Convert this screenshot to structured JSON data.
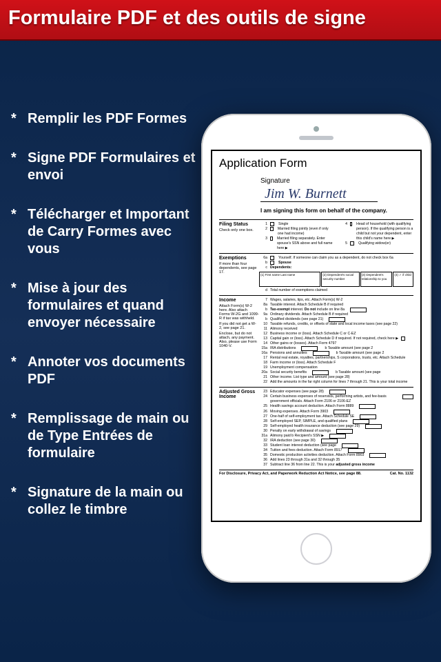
{
  "header": {
    "title": "Formulaire PDF et des outils de signe"
  },
  "features": [
    "Remplir les PDF Formes",
    "Signe PDF Formulaires et envoi",
    "Télécharger et Important de Carry Formes avec vous",
    "Mise à jour des formulaires et quand envoyer nécessaire",
    "Annoter vos documents PDF",
    "Remplissage de main ou de Type Entrées de formulaire",
    "Signature de la main ou collez le timbre"
  ],
  "form": {
    "title": "Application Form",
    "signature_label": "Signature",
    "signature_value": "Jim W. Burnett",
    "signature_note": "I am signing this form on behalf of the company.",
    "filing_status": {
      "label": "Filing Status",
      "sub": "Check only one box.",
      "options": [
        "Single",
        "Married filing jointly (even if only one had income)",
        "Married filing separately. Enter spouse's SSN above and full name here ▶",
        "Head of household (with qualifying person). If the qualifying person is a child but not your dependent, enter this child's name here ▶",
        "Qualifying widow(er)"
      ]
    },
    "exemptions": {
      "label": "Exemptions",
      "sub": "If more than four dependents, see page 17.",
      "a": "Yourself. If someone can claim you as a dependent, do not check box 6a",
      "b": "Spouse",
      "c": "Dependents:",
      "cols": [
        "(1) First name    Last name",
        "(2) Dependent's social security number",
        "(3) Dependent's relationship to you",
        "(4) ✓ if child"
      ],
      "d": "Total number of exemptions claimed"
    },
    "income": {
      "label": "Income",
      "sub": "Attach Form(s) W-2 here. Also attach Forms W-2G and 1099-R if tax was withheld.",
      "sub2": "If you did not get a W-2, see page 21.",
      "sub3": "Enclose, but do not attach, any payment. Also, please use Form 1040-V.",
      "lines": {
        "7": "Wages, salaries, tips, etc. Attach Form(s) W-2",
        "8a": "Taxable interest. Attach Schedule B if required",
        "8b": "Tax-exempt interest. Do not include on line 8a",
        "9a": "Ordinary dividends. Attach Schedule B if required",
        "9b": "Qualified dividends (see page 21)",
        "10": "Taxable refunds, credits, or offsets of state and local income taxes (see page 22)",
        "11": "Alimony received",
        "12": "Business income or (loss). Attach Schedule C or C-EZ",
        "13": "Capital gain or (loss). Attach Schedule D if required. If not required, check here ▶",
        "14": "Other gains or (losses). Attach Form 4797",
        "15a": "IRA distributions",
        "15b": "b Taxable amount (see page 2",
        "16a": "Pensions and annuities",
        "16b": "b Taxable amount (see page 2",
        "17": "Rental real estate, royalties, partnerships, S corporations, trusts, etc. Attach Schedule",
        "18": "Farm income or (loss). Attach Schedule F",
        "19": "Unemployment compensation",
        "20a": "Social security benefits",
        "20b": "b Taxable amount (see page",
        "21": "Other income. List type and amount (see page 28)",
        "22": "Add the amounts in the far right column for lines 7 through 21. This is your total income"
      }
    },
    "agi": {
      "label": "Adjusted Gross Income",
      "lines": {
        "23": "Educator expenses (see page 28)",
        "24": "Certain business expenses of reservists, performing artists, and fee-basis government officials. Attach Form 2106 or 2106-EZ",
        "25": "Health savings account deduction. Attach Form 8889",
        "26": "Moving expenses. Attach Form 3903",
        "27": "One-half of self-employment tax. Attach Schedule SE",
        "28": "Self-employed SEP, SIMPLE, and qualified plans",
        "29": "Self-employed health insurance deduction (see page 29)",
        "30": "Penalty on early withdrawal of savings",
        "31a": "Alimony paid  b Recipient's SSN ▶",
        "32": "IRA deduction (see page 30)",
        "33": "Student loan interest deduction (see page",
        "34": "Tuition and fees deduction. Attach Form 8917",
        "35": "Domestic production activities deduction. Attach Form 8903",
        "36": "Add lines 23 through 31a and 32 through 35",
        "37": "Subtract line 36 from line 22. This is your adjusted gross income"
      }
    },
    "footer": {
      "left": "For Disclosure, Privacy Act, and Paperwork Reduction Act Notice, see page 88.",
      "right": "Cat. No. 1132"
    }
  }
}
